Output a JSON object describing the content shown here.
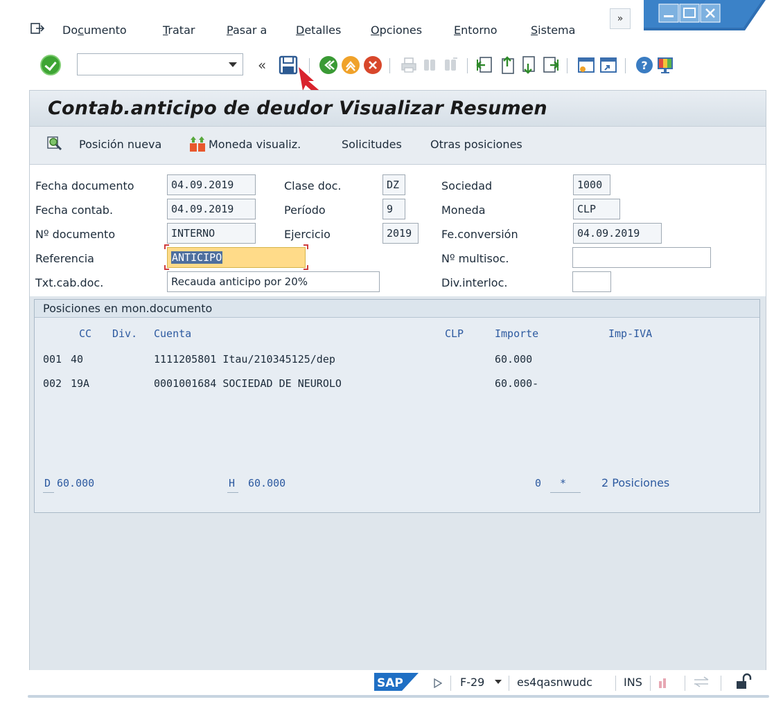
{
  "menu": {
    "items": [
      {
        "pre": "Do",
        "ul": "c",
        "post": "umento"
      },
      {
        "pre": "",
        "ul": "T",
        "post": "ratar"
      },
      {
        "pre": "",
        "ul": "P",
        "post": "asar a"
      },
      {
        "pre": "",
        "ul": "D",
        "post": "etalles"
      },
      {
        "pre": "",
        "ul": "O",
        "post": "pciones"
      },
      {
        "pre": "",
        "ul": "E",
        "post": "ntorno"
      },
      {
        "pre": "",
        "ul": "S",
        "post": "istema"
      }
    ],
    "overflow": "»"
  },
  "toolbar": {
    "command_value": "",
    "back_double": "«"
  },
  "screen": {
    "title": "Contab.anticipo de deudor Visualizar Resumen",
    "app_toolbar": {
      "new_item": "Posición nueva",
      "currency": "Moneda visualiz.",
      "requests": "Solicitudes",
      "other_items": "Otras posiciones"
    }
  },
  "form": {
    "doc_date": {
      "label": "Fecha documento",
      "value": "04.09.2019"
    },
    "doc_type": {
      "label": "Clase doc.",
      "value": "DZ"
    },
    "company": {
      "label": "Sociedad",
      "value": "1000"
    },
    "post_date": {
      "label": "Fecha contab.",
      "value": "04.09.2019"
    },
    "period": {
      "label": "Período",
      "value": "9"
    },
    "currency": {
      "label": "Moneda",
      "value": "CLP"
    },
    "doc_number": {
      "label": "Nº documento",
      "value": "INTERNO"
    },
    "fiscal_year": {
      "label": "Ejercicio",
      "value": "2019"
    },
    "conversion_date": {
      "label": "Fe.conversión",
      "value": "04.09.2019"
    },
    "reference": {
      "label": "Referencia",
      "value": "ANTICIPO"
    },
    "cross_company": {
      "label": "Nº multisoc.",
      "value": ""
    },
    "header_text": {
      "label": "Txt.cab.doc.",
      "value": "Recauda anticipo por 20%"
    },
    "partner_div": {
      "label": "Div.interloc.",
      "value": ""
    }
  },
  "positions": {
    "title": "Posiciones en mon.documento",
    "headers": {
      "cc": "CC",
      "div": "Div.",
      "account": "Cuenta",
      "currency": "CLP",
      "amount": "Importe",
      "tax": "Imp-IVA"
    },
    "rows": [
      {
        "no": "001",
        "cc": "40",
        "div": "",
        "account": "1111205801 Itau/210345125/dep",
        "amount": "60.000",
        "tax": ""
      },
      {
        "no": "002",
        "cc": "19A",
        "div": "",
        "account": "0001001684 SOCIEDAD DE NEUROLO",
        "amount": "60.000-",
        "tax": ""
      }
    ],
    "footer": {
      "debit_label": "D",
      "debit_value": "60.000",
      "credit_label": "H",
      "credit_value": "60.000",
      "balance": "0",
      "balance_flag": "*",
      "count_text": "2 Posiciones"
    }
  },
  "statusbar": {
    "logo": "SAP",
    "transaction": "F-29",
    "server": "es4qasnwudc",
    "mode": "INS"
  }
}
